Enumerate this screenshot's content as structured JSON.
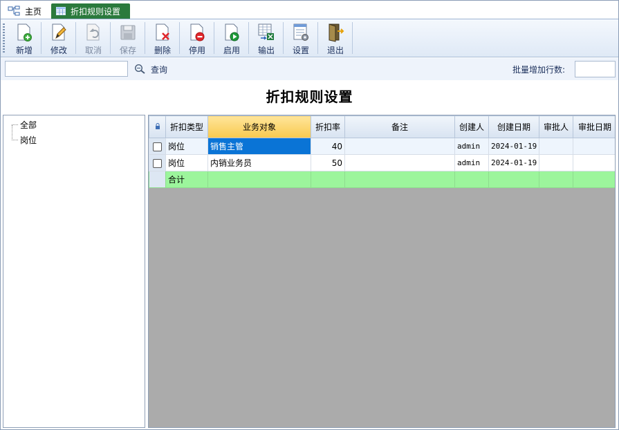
{
  "tabs": [
    {
      "label": "主页",
      "icon": "home-tree-icon"
    },
    {
      "label": "折扣规则设置",
      "icon": "table-icon"
    }
  ],
  "toolbar": {
    "buttons": [
      {
        "label": "新增",
        "icon": "new-document-icon",
        "enabled": true
      },
      {
        "label": "修改",
        "icon": "edit-document-icon",
        "enabled": true
      },
      {
        "label": "取消",
        "icon": "undo-document-icon",
        "enabled": false
      },
      {
        "label": "保存",
        "icon": "save-disk-icon",
        "enabled": false
      },
      {
        "label": "删除",
        "icon": "delete-document-icon",
        "enabled": true
      },
      {
        "label": "停用",
        "icon": "stop-document-icon",
        "enabled": true
      },
      {
        "label": "启用",
        "icon": "start-document-icon",
        "enabled": true
      },
      {
        "label": "输出",
        "icon": "export-excel-icon",
        "enabled": true
      },
      {
        "label": "设置",
        "icon": "settings-icon",
        "enabled": true
      },
      {
        "label": "退出",
        "icon": "exit-door-icon",
        "enabled": true
      }
    ]
  },
  "search": {
    "value": "",
    "query_label": "查询",
    "batch_label": "批量增加行数:",
    "batch_value": ""
  },
  "page_title": "折扣规则设置",
  "tree": {
    "items": [
      "全部",
      "岗位"
    ]
  },
  "grid": {
    "columns": [
      "折扣类型",
      "业务对象",
      "折扣率",
      "备注",
      "创建人",
      "创建日期",
      "审批人",
      "审批日期"
    ],
    "sorted_column": "业务对象",
    "rows": [
      {
        "type": "岗位",
        "object": "销售主管",
        "rate": "40",
        "note": "",
        "creator": "admin",
        "created": "2024-01-19",
        "approver": "",
        "approved": ""
      },
      {
        "type": "岗位",
        "object": "内销业务员",
        "rate": "50",
        "note": "",
        "creator": "admin",
        "created": "2024-01-19",
        "approver": "",
        "approved": ""
      }
    ],
    "total_label": "合计"
  },
  "colors": {
    "tab_active": "#2b7a3d",
    "selected_cell": "#0a74d6",
    "total_row": "#9cf59c",
    "sorted_header": "#f8c94f"
  }
}
